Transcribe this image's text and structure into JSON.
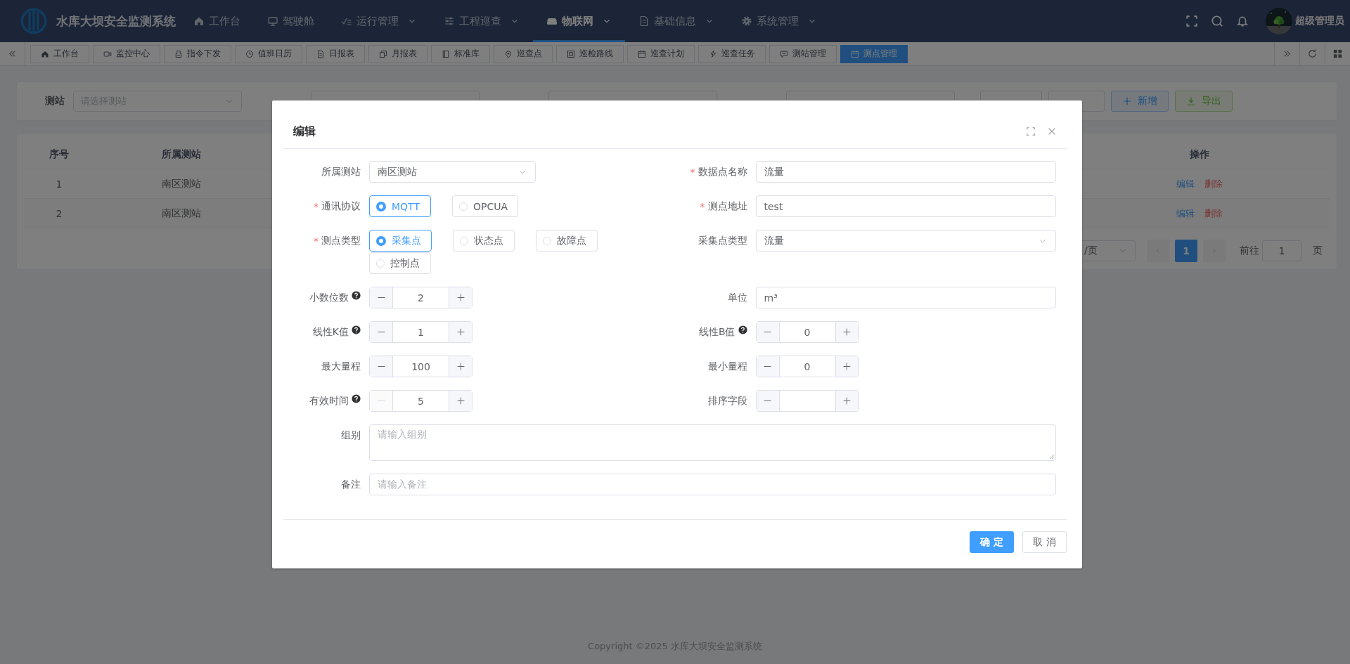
{
  "header": {
    "title": "水库大坝安全监测系统",
    "nav": [
      {
        "label": "工作台",
        "expandable": false,
        "selected": false
      },
      {
        "label": "驾驶舱",
        "expandable": false,
        "selected": false
      },
      {
        "label": "运行管理",
        "expandable": true,
        "selected": false
      },
      {
        "label": "工程巡查",
        "expandable": true,
        "selected": false
      },
      {
        "label": "物联网",
        "expandable": true,
        "selected": true
      },
      {
        "label": "基础信息",
        "expandable": true,
        "selected": false
      },
      {
        "label": "系统管理",
        "expandable": true,
        "selected": false
      }
    ],
    "user": {
      "name": "超级管理员"
    }
  },
  "tabs": [
    {
      "label": "工作台",
      "selected": false
    },
    {
      "label": "监控中心",
      "selected": false
    },
    {
      "label": "指令下发",
      "selected": false
    },
    {
      "label": "值班日历",
      "selected": false
    },
    {
      "label": "日报表",
      "selected": false
    },
    {
      "label": "月报表",
      "selected": false
    },
    {
      "label": "标准库",
      "selected": false
    },
    {
      "label": "巡查点",
      "selected": false
    },
    {
      "label": "巡检路线",
      "selected": false
    },
    {
      "label": "巡查计划",
      "selected": false
    },
    {
      "label": "巡查任务",
      "selected": false
    },
    {
      "label": "测站管理",
      "selected": false
    },
    {
      "label": "测点管理",
      "selected": true
    }
  ],
  "search_form": {
    "fields": [
      {
        "label": "测站",
        "placeholder": "请选择测站",
        "kind": "select"
      }
    ],
    "buttons": [
      {
        "label": "新增",
        "kind": "add"
      },
      {
        "label": "导出",
        "kind": "export"
      }
    ]
  },
  "table": {
    "columns": [
      "序号",
      "所属测站",
      "操作"
    ],
    "rows": [
      {
        "index": "1",
        "station": "南区测站",
        "actions": [
          "编辑",
          "删除"
        ]
      },
      {
        "index": "2",
        "station": "南区测站",
        "actions": [
          "编辑",
          "删除"
        ]
      }
    ]
  },
  "pagination": {
    "page_size": "/页",
    "pages": [
      {
        "label": "1",
        "selected": true
      }
    ],
    "goto_label": "前往",
    "goto_value": "1",
    "goto_suffix": "页"
  },
  "dialog": {
    "title": "编辑",
    "fields": [
      {
        "label": "所属测站",
        "kind": "select",
        "value": "南区测站"
      },
      {
        "mark": "*",
        "label": "数据点名称",
        "kind": "input",
        "value": "流量"
      },
      {
        "mark": "*",
        "label": "通讯协议",
        "kind": "radio",
        "options": [
          {
            "label": "MQTT",
            "selected": true
          },
          {
            "label": "OPCUA",
            "selected": false
          }
        ]
      },
      {
        "mark": "*",
        "label": "测点地址",
        "kind": "input",
        "value": "test"
      },
      {
        "mark": "*",
        "label": "测点类型",
        "kind": "radio",
        "options": [
          {
            "label": "采集点",
            "selected": true
          },
          {
            "label": "状态点",
            "selected": false
          },
          {
            "label": "故障点",
            "selected": false
          },
          {
            "label": "控制点",
            "selected": false
          }
        ]
      },
      {
        "label": "采集点类型",
        "kind": "select",
        "value": "流量"
      },
      {
        "label": "小数位数",
        "help": true,
        "kind": "number",
        "value": "2",
        "decrease_disabled": false
      },
      {
        "label": "单位",
        "kind": "input",
        "value": "m³"
      },
      {
        "label": "线性K值",
        "help": true,
        "kind": "number",
        "value": "1",
        "decrease_disabled": false
      },
      {
        "label": "线性B值",
        "help": true,
        "kind": "number",
        "value": "0",
        "decrease_disabled": false
      },
      {
        "label": "最大量程",
        "kind": "number",
        "value": "100",
        "decrease_disabled": false
      },
      {
        "label": "最小量程",
        "kind": "number",
        "value": "0",
        "decrease_disabled": false
      },
      {
        "label": "有效时间",
        "help": true,
        "kind": "number",
        "value": "5",
        "decrease_disabled": true
      },
      {
        "label": "排序字段",
        "kind": "number",
        "decrease_disabled": false
      },
      {
        "label": "组别",
        "kind": "textarea",
        "placeholder": "请输入组别",
        "wide": true
      },
      {
        "label": "备注",
        "kind": "input",
        "placeholder": "请输入备注",
        "wide": true
      }
    ],
    "buttons": [
      {
        "label": "确 定",
        "kind": "primary"
      },
      {
        "label": "取 消",
        "kind": "default"
      }
    ]
  },
  "footer": "Copyright ©2025 水库大坝安全监测系统"
}
